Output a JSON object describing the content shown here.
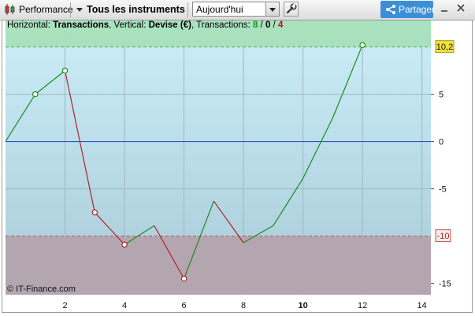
{
  "toolbar": {
    "performance_label": "Performance",
    "instruments_label": "Tous les instruments",
    "period_value": "Aujourd'hui",
    "share_label": "Partager",
    "minimize_icon": "minimize-icon",
    "close_icon": "close-icon"
  },
  "legend": {
    "horizontal_prefix": "Horizontal: ",
    "horizontal_value": "Transactions",
    "vertical_prefix": ", Vertical: ",
    "vertical_value": "Devise (€)",
    "transactions_prefix": ", Transactions: ",
    "count_positive": "8",
    "sep1": " / ",
    "count_zero": "0",
    "sep2": " / ",
    "count_negative": "4"
  },
  "watermark": "© IT-Finance.com",
  "colors": {
    "up": "#1a8c1a",
    "down": "#b3202a",
    "zero_line": "#1f3fbf",
    "upper_zone": "#a8e0bc",
    "lower_zone": "#b3a3ad",
    "bg_top": "#cbeefa",
    "bg_bottom": "#a9cbd8"
  },
  "chart_data": {
    "type": "line",
    "x": [
      0,
      1,
      2,
      3,
      4,
      5,
      6,
      7,
      8,
      9,
      10,
      11,
      12
    ],
    "values": [
      0,
      5,
      7.5,
      -7.5,
      -10.9,
      -8.9,
      -14.5,
      -6.3,
      -10.7,
      -8.9,
      -3.9,
      2.5,
      10.2
    ],
    "markers": [
      1,
      2,
      3,
      4,
      6,
      12
    ],
    "xlim": [
      0,
      14.3
    ],
    "ylim": [
      -16.2,
      12.8
    ],
    "x_ticks": [
      "2",
      "4",
      "6",
      "8",
      "10",
      "12",
      "14"
    ],
    "x_tick_values": [
      2,
      4,
      6,
      8,
      10,
      12,
      14
    ],
    "x_bold_tick": "10",
    "y_ticks": [
      "5",
      "0",
      "-5",
      "-15"
    ],
    "y_tick_values": [
      5,
      0,
      -5,
      -15
    ],
    "upper_threshold": 10,
    "lower_threshold": -10,
    "upper_label": "10,2",
    "lower_label": "-10",
    "grid": true
  }
}
